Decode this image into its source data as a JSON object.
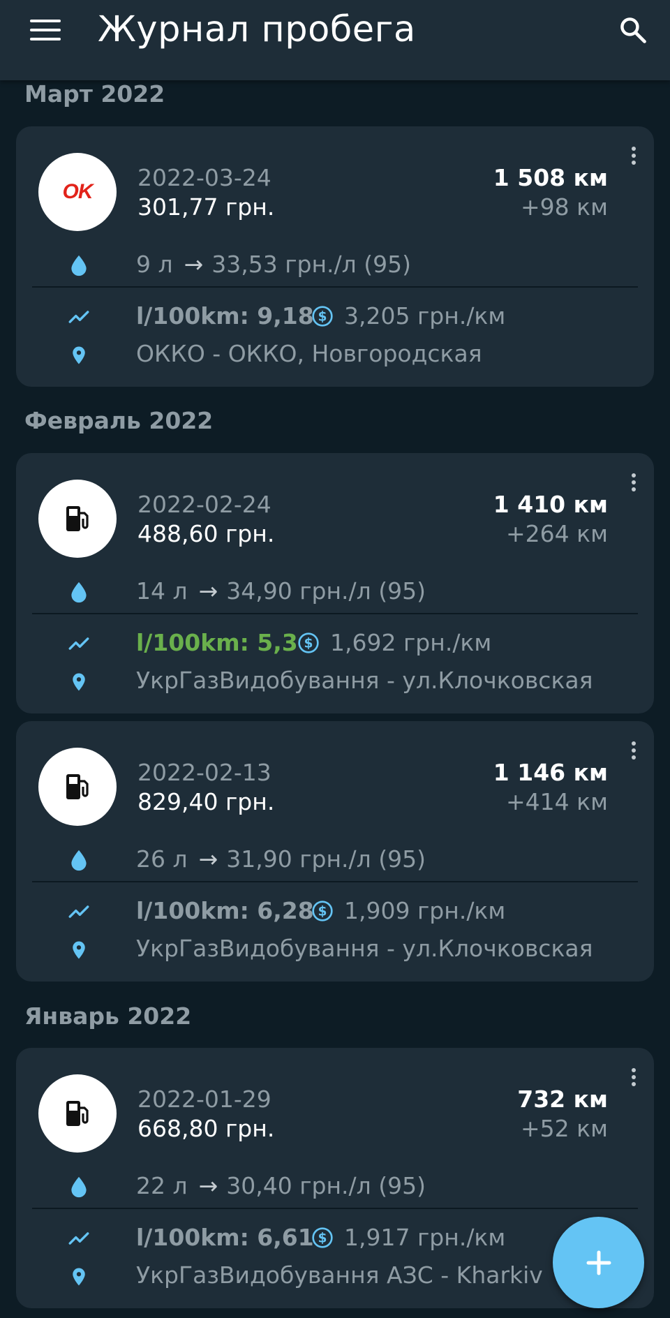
{
  "app_bar": {
    "title": "Журнал пробега",
    "menu_icon": "menu-icon",
    "search_icon": "search-icon"
  },
  "colors": {
    "background": "#0d1c25",
    "card": "#1e2d38",
    "accent": "#64c4f4",
    "good_consumption": "#6ab04c",
    "muted_text": "#8f9ca4"
  },
  "sections": [
    {
      "month": "Март 2022"
    },
    {
      "month": "Февраль 2022"
    },
    {
      "month": "Январь 2022"
    }
  ],
  "entries": [
    {
      "logo": "okko-logo",
      "logo_text": "OK",
      "date": "2022-03-24",
      "price": "301,77 грн.",
      "odometer": "1 508 км",
      "distance": "+98 км",
      "volume": "9 л",
      "unit_price": "33,53 грн./л",
      "fuel_type": "(95)",
      "consumption": "l/100km: 9,18",
      "cost_per_km": "3,205 грн./км",
      "station": "ОККО - ОККО, Новгородская"
    },
    {
      "logo": "fuel-pump-icon",
      "date": "2022-02-24",
      "price": "488,60 грн.",
      "odometer": "1 410 км",
      "distance": "+264 км",
      "volume": "14 л",
      "unit_price": "34,90 грн./л",
      "fuel_type": "(95)",
      "consumption": "l/100km: 5,3",
      "cost_per_km": "1,692 грн./км",
      "station": "УкрГазВидобування - ул.Клочковская"
    },
    {
      "logo": "fuel-pump-icon",
      "date": "2022-02-13",
      "price": "829,40 грн.",
      "odometer": "1 146 км",
      "distance": "+414 км",
      "volume": "26 л",
      "unit_price": "31,90 грн./л",
      "fuel_type": "(95)",
      "consumption": "l/100km: 6,28",
      "cost_per_km": "1,909 грн./км",
      "station": "УкрГазВидобування - ул.Клочковская"
    },
    {
      "logo": "fuel-pump-icon",
      "date": "2022-01-29",
      "price": "668,80 грн.",
      "odometer": "732 км",
      "distance": "+52 км",
      "volume": "22 л",
      "unit_price": "30,40 грн./л",
      "fuel_type": "(95)",
      "consumption": "l/100km: 6,61",
      "cost_per_km": "1,917 грн./км",
      "station": "УкрГазВидобування АЗС - Kharkiv"
    }
  ],
  "fab": {
    "icon": "plus-icon",
    "label": "+"
  },
  "icons": {
    "arrow": "→",
    "fuel_row": "water-drop-icon",
    "consumption_row": "trending-icon",
    "cost_row": "dollar-circle-icon",
    "station_row": "location-pin-icon",
    "more": "more-vert-icon"
  }
}
